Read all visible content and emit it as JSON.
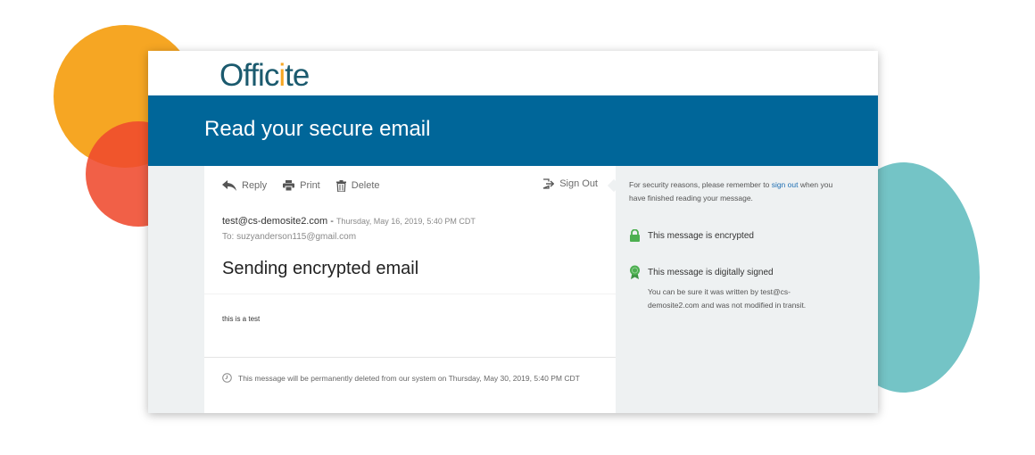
{
  "brand": {
    "logo_prefix": "Offic",
    "logo_accent": "i",
    "logo_suffix": "te",
    "logo_color": "#1b5a6e",
    "accent_color": "#f6a623"
  },
  "banner": {
    "title": "Read your secure email",
    "color": "#006699"
  },
  "toolbar": {
    "reply_label": "Reply",
    "print_label": "Print",
    "delete_label": "Delete",
    "signout_label": "Sign Out"
  },
  "message": {
    "from": "test@cs-demosite2.com",
    "separator": " - ",
    "date": "Thursday, May 16, 2019, 5:40 PM CDT",
    "to": "To: suzyanderson115@gmail.com",
    "subject": "Sending encrypted email",
    "body": "this is a test",
    "expiry_notice": "This message will be permanently deleted from our system on Thursday, May 30, 2019, 5:40 PM CDT"
  },
  "sidebar": {
    "notice_before_link": "For security reasons, please remember to ",
    "notice_link": "sign out",
    "notice_after_link": " when you have finished reading your message.",
    "encrypted_label": "This message is encrypted",
    "signed_label": "This message is digitally signed",
    "signed_detail": "You can be sure it was written by test@cs-demosite2.com and was not modified in transit.",
    "status_color": "#4caf50",
    "link_color": "#1f6fb3"
  }
}
